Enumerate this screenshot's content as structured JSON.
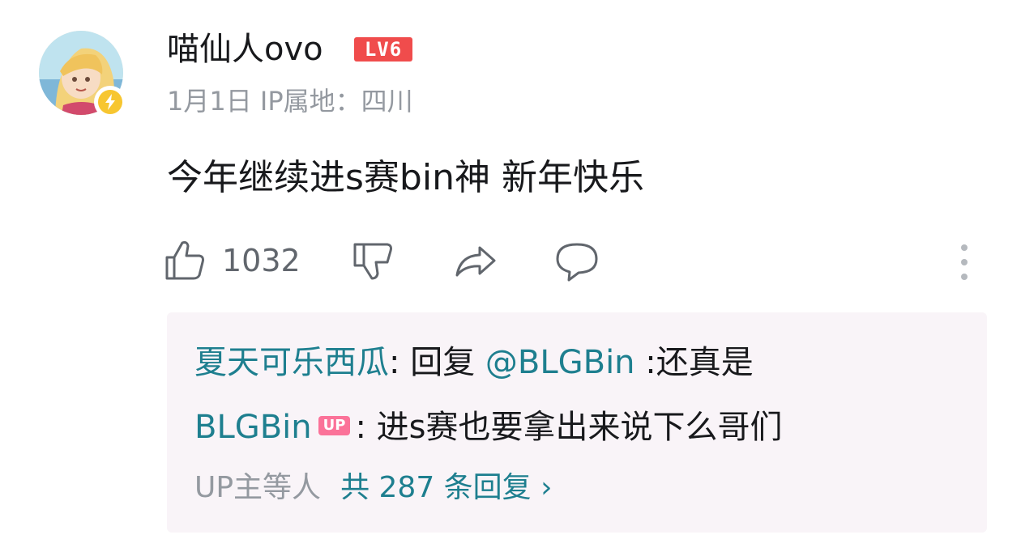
{
  "comment": {
    "username": "喵仙人ovo",
    "level_badge": "LV6",
    "meta": "1月1日 IP属地：四川",
    "content": "今年继续进s赛bin神 新年快乐",
    "like_count": "1032"
  },
  "icons": {
    "like": "thumbs-up-icon",
    "dislike": "thumbs-down-icon",
    "share": "share-icon",
    "reply": "comment-bubble-icon",
    "more": "more-vertical-icon",
    "avatar_badge": "lightning-icon",
    "chevron": "chevron-right-icon"
  },
  "replies": [
    {
      "user": "夏天可乐西瓜",
      "separator": ": 回复 ",
      "mention": "@BLGBin",
      "text": " :还真是"
    },
    {
      "user": "BLGBin",
      "badge": "UP",
      "text": ": 进s赛也要拿出来说下么哥们"
    }
  ],
  "reply_summary": {
    "prefix": "UP主等人",
    "link": "共 287 条回复",
    "chevron": "›"
  },
  "colors": {
    "level_badge": "#f04c4c",
    "link": "#1e7f8f",
    "up_badge": "#fb7299",
    "reply_bg": "#f9f4f8",
    "meta": "#9499a0"
  }
}
